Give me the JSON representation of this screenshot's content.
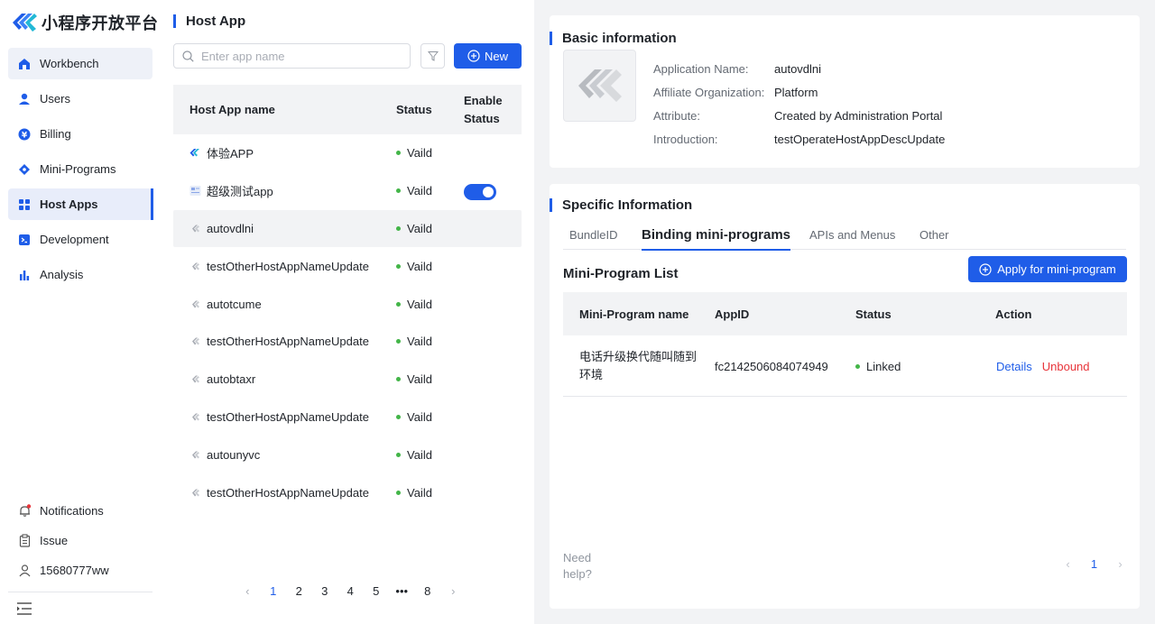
{
  "brand": {
    "name": "小程序开放平台",
    "accent": "#1f5de8"
  },
  "sidebar": {
    "items": [
      {
        "label": "Workbench",
        "icon": "home-icon"
      },
      {
        "label": "Users",
        "icon": "user-icon"
      },
      {
        "label": "Billing",
        "icon": "yuan-icon"
      },
      {
        "label": "Mini-Programs",
        "icon": "diamond-icon"
      },
      {
        "label": "Host Apps",
        "icon": "grid-icon"
      },
      {
        "label": "Development",
        "icon": "terminal-icon"
      },
      {
        "label": "Analysis",
        "icon": "bar-chart-icon"
      }
    ],
    "bottom": [
      {
        "label": "Notifications",
        "icon": "bell-icon"
      },
      {
        "label": "Issue",
        "icon": "clipboard-icon"
      },
      {
        "label": "15680777ww",
        "icon": "person-icon"
      }
    ]
  },
  "host_list": {
    "title": "Host App",
    "search_placeholder": "Enter app name",
    "new_label": "New",
    "columns": {
      "name": "Host App name",
      "status": "Status",
      "enable_line1": "Enable",
      "enable_line2": "Status"
    },
    "rows": [
      {
        "name": "体验APP",
        "status": "Vaild",
        "enabled": false
      },
      {
        "name": "超级测试app",
        "status": "Vaild",
        "enabled": true
      },
      {
        "name": "autovdlni",
        "status": "Vaild",
        "enabled": false
      },
      {
        "name": "testOtherHostAppNameUpdate",
        "status": "Vaild",
        "enabled": false
      },
      {
        "name": "autotcume",
        "status": "Vaild",
        "enabled": false
      },
      {
        "name": "testOtherHostAppNameUpdate",
        "status": "Vaild",
        "enabled": false
      },
      {
        "name": "autobtaxr",
        "status": "Vaild",
        "enabled": false
      },
      {
        "name": "testOtherHostAppNameUpdate",
        "status": "Vaild",
        "enabled": false
      },
      {
        "name": "autounyvc",
        "status": "Vaild",
        "enabled": false
      },
      {
        "name": "testOtherHostAppNameUpdate",
        "status": "Vaild",
        "enabled": false
      }
    ],
    "pages": [
      "1",
      "2",
      "3",
      "4",
      "5",
      "•••",
      "8"
    ],
    "current_page": "1"
  },
  "basic": {
    "title": "Basic information",
    "fields": [
      {
        "key": "Application Name:",
        "value": "autovdlni"
      },
      {
        "key": "Affiliate Organization:",
        "value": "Platform"
      },
      {
        "key": "Attribute:",
        "value": "Created by Administration Portal"
      },
      {
        "key": "Introduction:",
        "value": "testOperateHostAppDescUpdate"
      }
    ]
  },
  "specific": {
    "title": "Specific Information",
    "tabs": [
      "BundleID",
      "Binding mini-programs",
      "APIs and Menus",
      "Other"
    ],
    "active_tab": "Binding mini-programs",
    "list_title": "Mini-Program List",
    "apply_label": "Apply for mini-program",
    "columns": [
      "Mini-Program name",
      "AppID",
      "Status",
      "Action"
    ],
    "rows": [
      {
        "name_line1": "电话升级换代随叫随到",
        "name_line2": "环境",
        "appid": "fc2142506084074949",
        "status": "Linked",
        "action_details": "Details",
        "action_unbound": "Unbound"
      }
    ],
    "help_line1": "Need",
    "help_line2": "help?",
    "current_page": "1"
  }
}
